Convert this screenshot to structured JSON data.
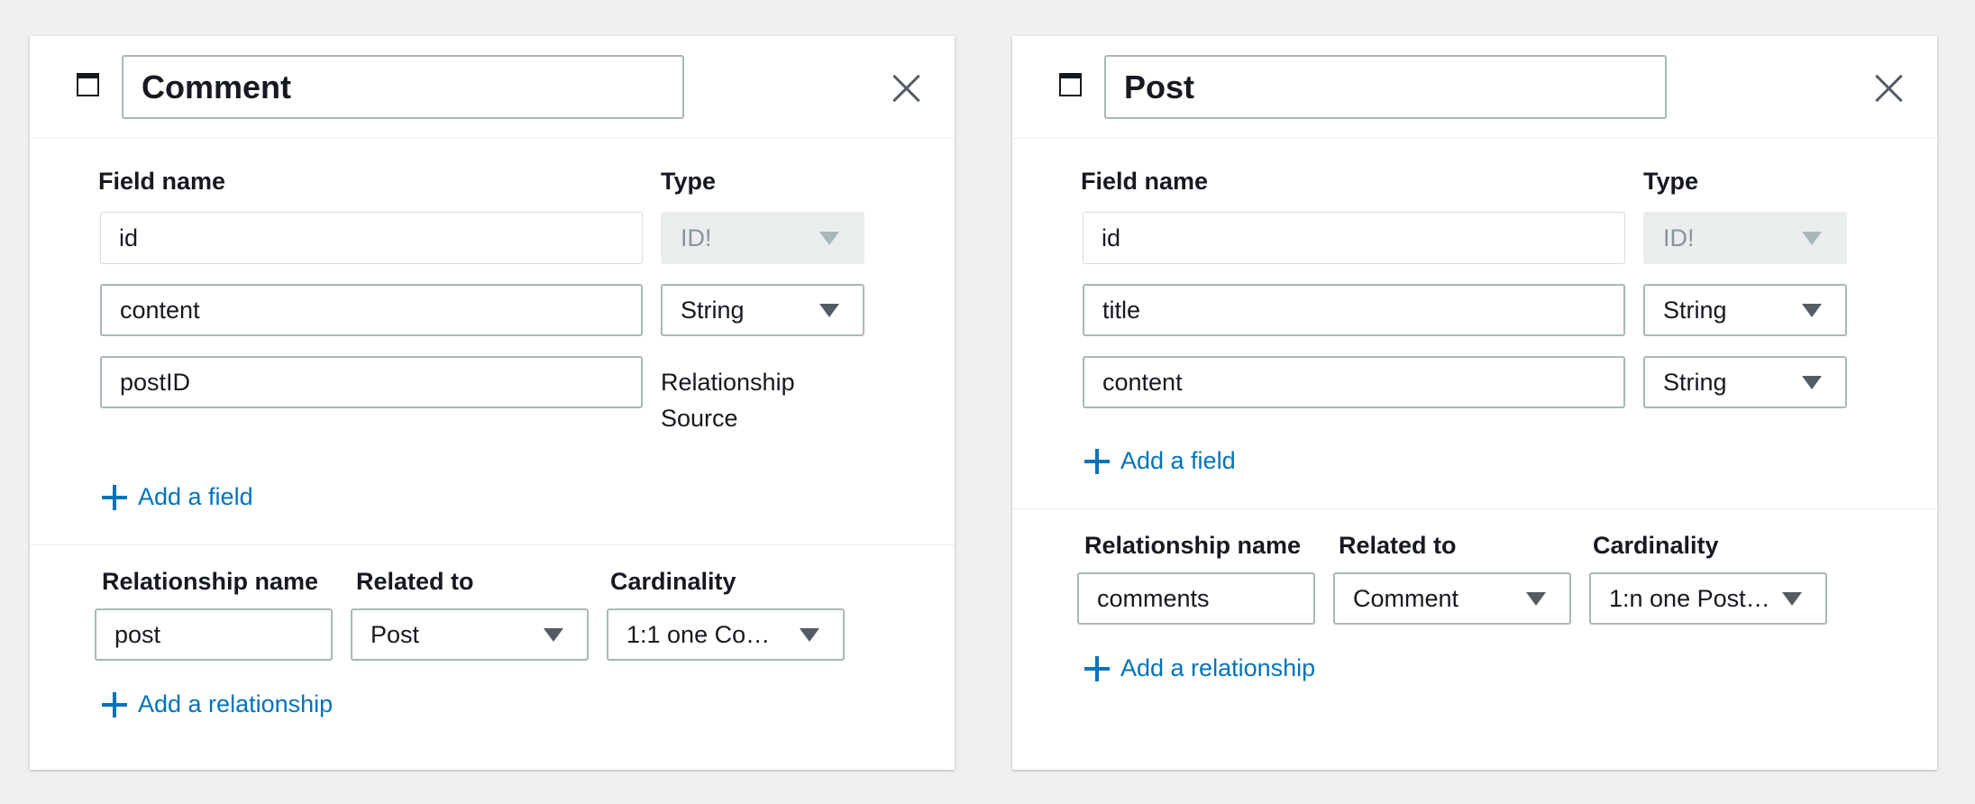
{
  "cards": [
    {
      "model_name": "Comment",
      "field_name_label": "Field name",
      "type_label": "Type",
      "fields": [
        {
          "name": "id",
          "type": "ID!"
        },
        {
          "name": "content",
          "type": "String"
        },
        {
          "name": "postID",
          "type": "Relationship Source"
        }
      ],
      "add_field_label": "Add a field",
      "relationship_name_label": "Relationship name",
      "related_to_label": "Related to",
      "cardinality_label": "Cardinality",
      "relationships": [
        {
          "name": "post",
          "related_to": "Post",
          "cardinality": "1:1 one Co…"
        }
      ],
      "add_relationship_label": "Add a relationship"
    },
    {
      "model_name": "Post",
      "field_name_label": "Field name",
      "type_label": "Type",
      "fields": [
        {
          "name": "id",
          "type": "ID!"
        },
        {
          "name": "title",
          "type": "String"
        },
        {
          "name": "content",
          "type": "String"
        }
      ],
      "add_field_label": "Add a field",
      "relationship_name_label": "Relationship name",
      "related_to_label": "Related to",
      "cardinality_label": "Cardinality",
      "relationships": [
        {
          "name": "comments",
          "related_to": "Comment",
          "cardinality": "1:n one Post…"
        }
      ],
      "add_relationship_label": "Add a relationship"
    }
  ],
  "colors": {
    "link": "#0073bb",
    "border": "#aab7b8",
    "disabled_bg": "#eaeded",
    "page_bg": "#eff0f0"
  },
  "icons": [
    "window-icon",
    "close-icon",
    "chevron-down-icon",
    "plus-icon"
  ]
}
